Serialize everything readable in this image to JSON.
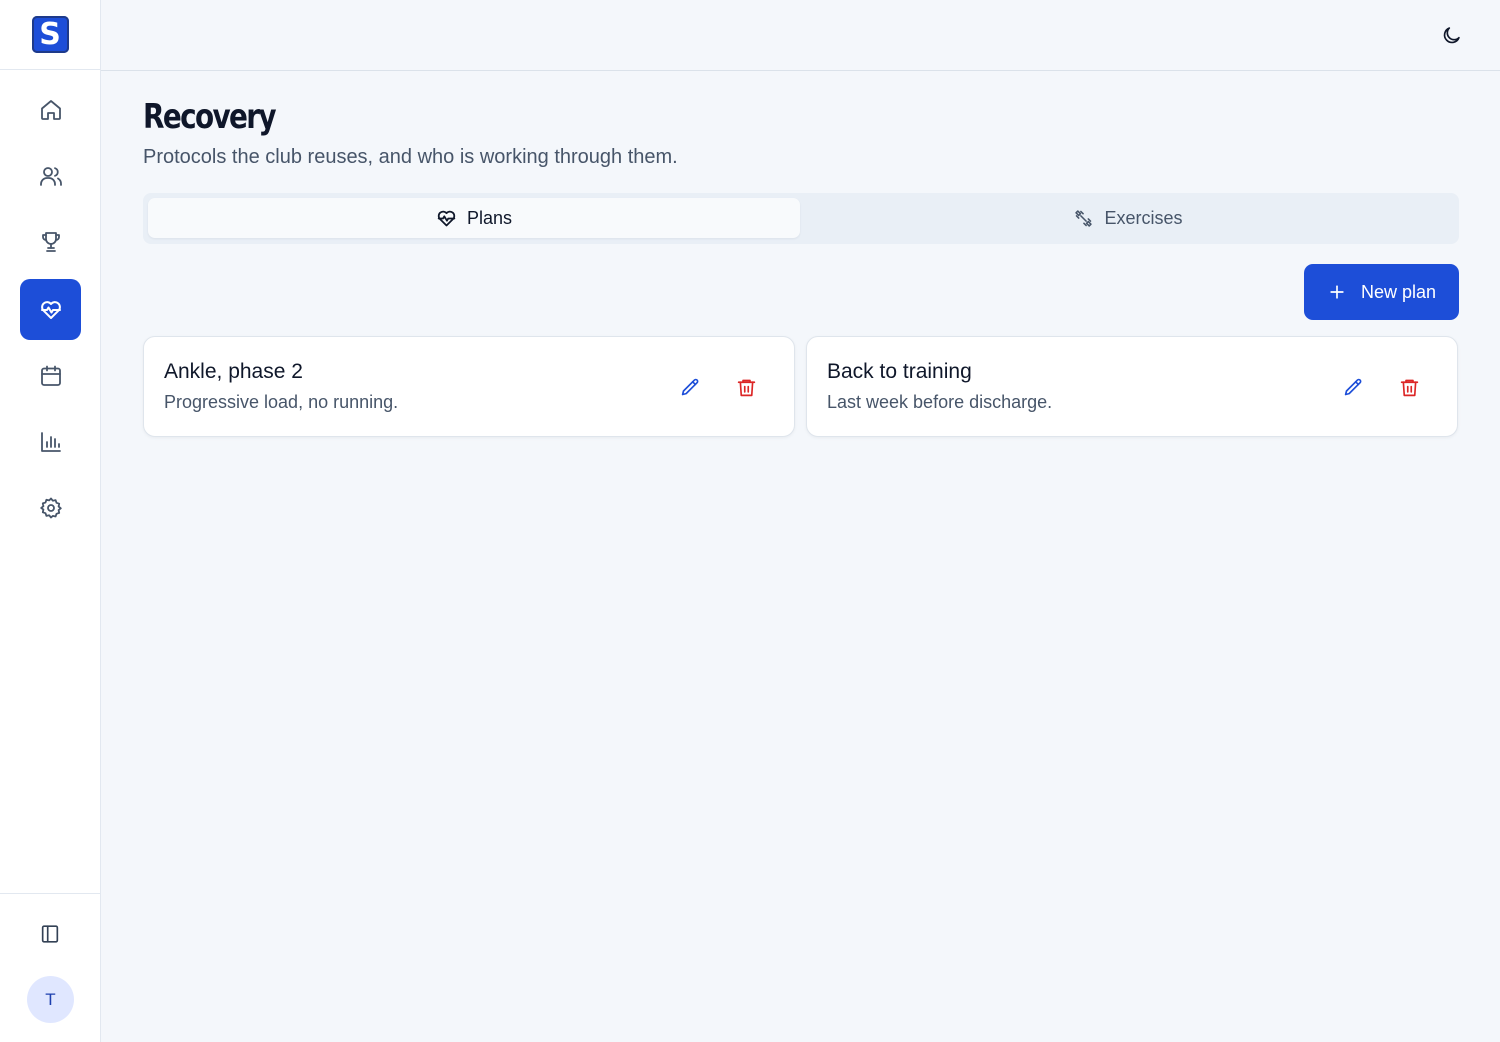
{
  "app": {
    "logo_letter": "S",
    "brand_color": "#1d4ed8"
  },
  "sidebar": {
    "items": [
      {
        "name": "home",
        "icon": "home-icon",
        "active": false
      },
      {
        "name": "members",
        "icon": "users-icon",
        "active": false
      },
      {
        "name": "competitions",
        "icon": "trophy-icon",
        "active": false
      },
      {
        "name": "recovery",
        "icon": "heart-pulse-icon",
        "active": true
      },
      {
        "name": "calendar",
        "icon": "calendar-icon",
        "active": false
      },
      {
        "name": "stats",
        "icon": "bar-chart-icon",
        "active": false
      },
      {
        "name": "settings",
        "icon": "gear-icon",
        "active": false
      }
    ],
    "collapse_icon": "sidebar-panel-icon",
    "avatar_initial": "T"
  },
  "topbar": {
    "theme_icon": "moon-icon"
  },
  "page": {
    "title": "Recovery",
    "subtitle": "Protocols the club reuses, and who is working through them."
  },
  "tabs": [
    {
      "label": "Plans",
      "icon": "heart-pulse-icon",
      "active": true
    },
    {
      "label": "Exercises",
      "icon": "dumbbell-icon",
      "active": false
    }
  ],
  "actions": {
    "new_plan_label": "New plan"
  },
  "plans": [
    {
      "title": "Ankle, phase 2",
      "description": "Progressive load, no running."
    },
    {
      "title": "Back to training",
      "description": "Last week before discharge."
    }
  ],
  "colors": {
    "accent": "#1d4ed8",
    "danger": "#dc2626",
    "background": "#f4f7fb"
  }
}
